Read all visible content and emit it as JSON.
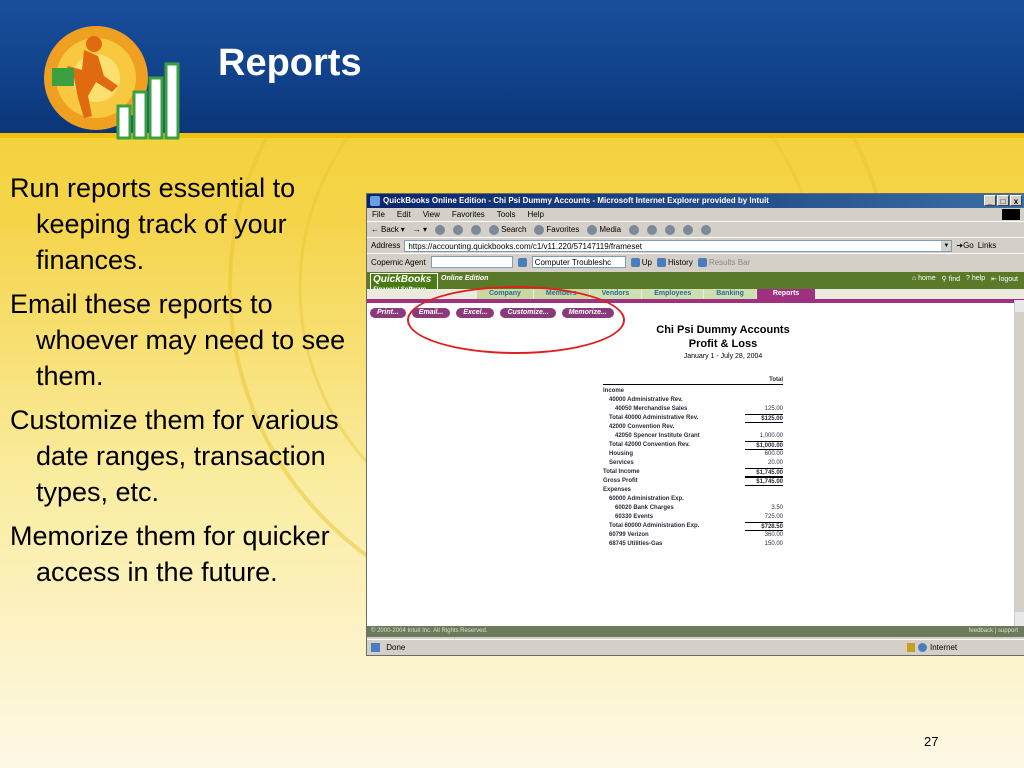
{
  "slide": {
    "title": "Reports",
    "page_number": "27",
    "bullets": [
      "Run reports essential to keeping track of your finances.",
      "Email these reports to whoever may need to see them.",
      "Customize them for various date ranges, transaction types, etc.",
      "Memorize them for quicker access in the future."
    ]
  },
  "browser": {
    "window_title": "QuickBooks Online Edition - Chi Psi Dummy Accounts - Microsoft Internet Explorer provided by Intuit",
    "window_buttons": [
      "_",
      "т",
      "x"
    ],
    "menu": [
      "File",
      "Edit",
      "View",
      "Favorites",
      "Tools",
      "Help"
    ],
    "toolbar": {
      "back": "Back",
      "search": "Search",
      "favorites": "Favorites",
      "media": "Media"
    },
    "address_label": "Address",
    "address_value": "https://accounting.quickbooks.com/c1/v11.220/57147119/frameset",
    "go_label": "Go",
    "links_label": "Links",
    "agent_label": "Copernic Agent",
    "agent_select": "Computer Troubleshc",
    "agent_up": "Up",
    "agent_history": "History",
    "agent_results": "Results Bar",
    "status_text": "Done",
    "status_zone": "Internet"
  },
  "qb": {
    "logo": "QuickBooks",
    "logo_sub": "Financial Software",
    "edition": "Online Edition",
    "top_links": [
      "home",
      "find",
      "help",
      "logout"
    ],
    "tabs": [
      {
        "label": "Company",
        "active": false
      },
      {
        "label": "Members",
        "active": false
      },
      {
        "label": "Vendors",
        "active": false
      },
      {
        "label": "Employees",
        "active": false
      },
      {
        "label": "Banking",
        "active": false
      },
      {
        "label": "Reports",
        "active": true
      }
    ],
    "actions": [
      "Print...",
      "Email...",
      "Excel...",
      "Customize...",
      "Memorize..."
    ],
    "report": {
      "company": "Chi Psi Dummy Accounts",
      "name": "Profit & Loss",
      "dates": "January 1 - July 28, 2004",
      "column": "Total",
      "rows": [
        {
          "label": "Income",
          "value": "",
          "indent": 0,
          "total": false
        },
        {
          "label": "40000 Administrative Rev.",
          "value": "",
          "indent": 1,
          "total": false
        },
        {
          "label": "40050 Merchandise Sales",
          "value": "125.00",
          "indent": 2,
          "total": false
        },
        {
          "label": "Total 40000 Administrative Rev.",
          "value": "$125.00",
          "indent": 1,
          "total": true
        },
        {
          "label": "42000 Convention Rev.",
          "value": "",
          "indent": 1,
          "total": false
        },
        {
          "label": "42050 Spencer Institute Grant",
          "value": "1,000.00",
          "indent": 2,
          "total": false
        },
        {
          "label": "Total 42000 Convention Rev.",
          "value": "$1,000.00",
          "indent": 1,
          "total": true
        },
        {
          "label": "Housing",
          "value": "600.00",
          "indent": 1,
          "total": false
        },
        {
          "label": "Services",
          "value": "20.00",
          "indent": 1,
          "total": false
        },
        {
          "label": "Total Income",
          "value": "$1,745.00",
          "indent": 0,
          "total": true
        },
        {
          "label": "Gross Profit",
          "value": "$1,745.00",
          "indent": 0,
          "total": true
        },
        {
          "label": "Expenses",
          "value": "",
          "indent": 0,
          "total": false
        },
        {
          "label": "60000 Administration Exp.",
          "value": "",
          "indent": 1,
          "total": false
        },
        {
          "label": "60020 Bank Charges",
          "value": "3.50",
          "indent": 2,
          "total": false
        },
        {
          "label": "60330 Events",
          "value": "725.00",
          "indent": 2,
          "total": false
        },
        {
          "label": "Total 60000 Administration Exp.",
          "value": "$728.50",
          "indent": 1,
          "total": true
        },
        {
          "label": "60799 Verizon",
          "value": "360.00",
          "indent": 1,
          "total": false
        },
        {
          "label": "68745 Utilities-Gas",
          "value": "150.00",
          "indent": 1,
          "total": false
        }
      ]
    },
    "footer_left": "© 2000-2004 Intuit Inc.  All Rights Reserved.",
    "footer_right": "feedback | support"
  },
  "colors": {
    "header_blue": "#0f3e86",
    "qb_green": "#5a7a2a",
    "reports_tab": "#a03080",
    "highlight_circle": "#e02020"
  }
}
